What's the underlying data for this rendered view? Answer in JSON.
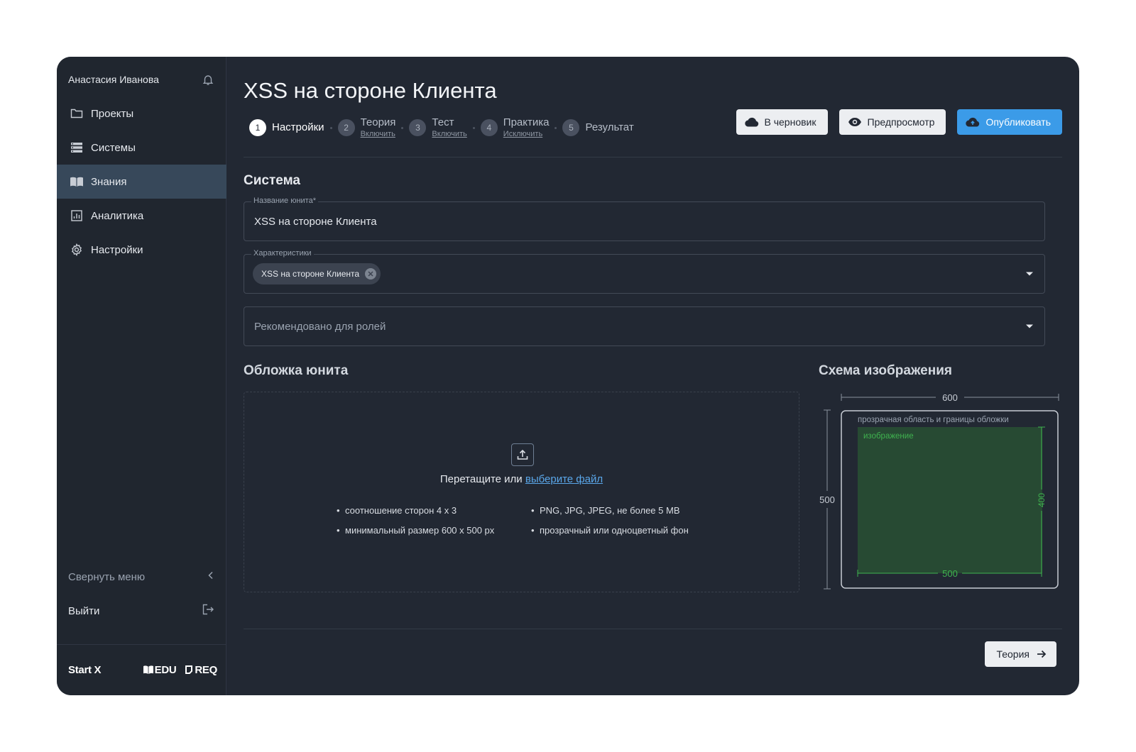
{
  "sidebar": {
    "user_name": "Анастасия Иванова",
    "items": [
      {
        "label": "Проекты",
        "icon": "folder-icon"
      },
      {
        "label": "Системы",
        "icon": "servers-icon"
      },
      {
        "label": "Знания",
        "icon": "book-icon",
        "active": true
      },
      {
        "label": "Аналитика",
        "icon": "chart-icon"
      },
      {
        "label": "Настройки",
        "icon": "gear-icon"
      }
    ],
    "collapse_label": "Свернуть меню",
    "logout_label": "Выйти",
    "brands": {
      "startx": "Start X",
      "edu": "EDU",
      "req": "REQ"
    }
  },
  "page": {
    "title": "XSS на стороне Клиента"
  },
  "steps": [
    {
      "num": "1",
      "label": "Настройки",
      "sub": ""
    },
    {
      "num": "2",
      "label": "Теория",
      "sub": "Включить"
    },
    {
      "num": "3",
      "label": "Тест",
      "sub": "Включить"
    },
    {
      "num": "4",
      "label": "Практика",
      "sub": "Исключить"
    },
    {
      "num": "5",
      "label": "Результат",
      "sub": ""
    }
  ],
  "actions": {
    "draft": "В черновик",
    "preview": "Предпросмотр",
    "publish": "Опубликовать"
  },
  "form": {
    "section_title": "Система",
    "unit_name_label": "Название юнита*",
    "unit_name_value": "XSS на стороне Клиента",
    "characteristics_label": "Характеристики",
    "characteristics_chip": "XSS на стороне Клиента",
    "roles_placeholder": "Рекомендовано для ролей"
  },
  "cover": {
    "title": "Обложка юнита",
    "drop_text": "Перетащите или",
    "drop_link": "выберите файл",
    "requirements_left": [
      "соотношение сторон 4 х 3",
      "минимальный размер 600 х 500 px"
    ],
    "requirements_right": [
      "PNG, JPG, JPEG, не более 5 MB",
      "прозрачный или одноцветный фон"
    ]
  },
  "scheme": {
    "title": "Схема изображения",
    "outer_width": "600",
    "outer_height": "500",
    "outer_label": "прозрачная область и границы обложки",
    "inner_label": "изображение",
    "inner_width": "500",
    "inner_height": "400"
  },
  "footer": {
    "next_label": "Теория"
  },
  "colors": {
    "background": "#222833",
    "accent": "#3b9be8",
    "scheme_green": "#3fb24f"
  }
}
